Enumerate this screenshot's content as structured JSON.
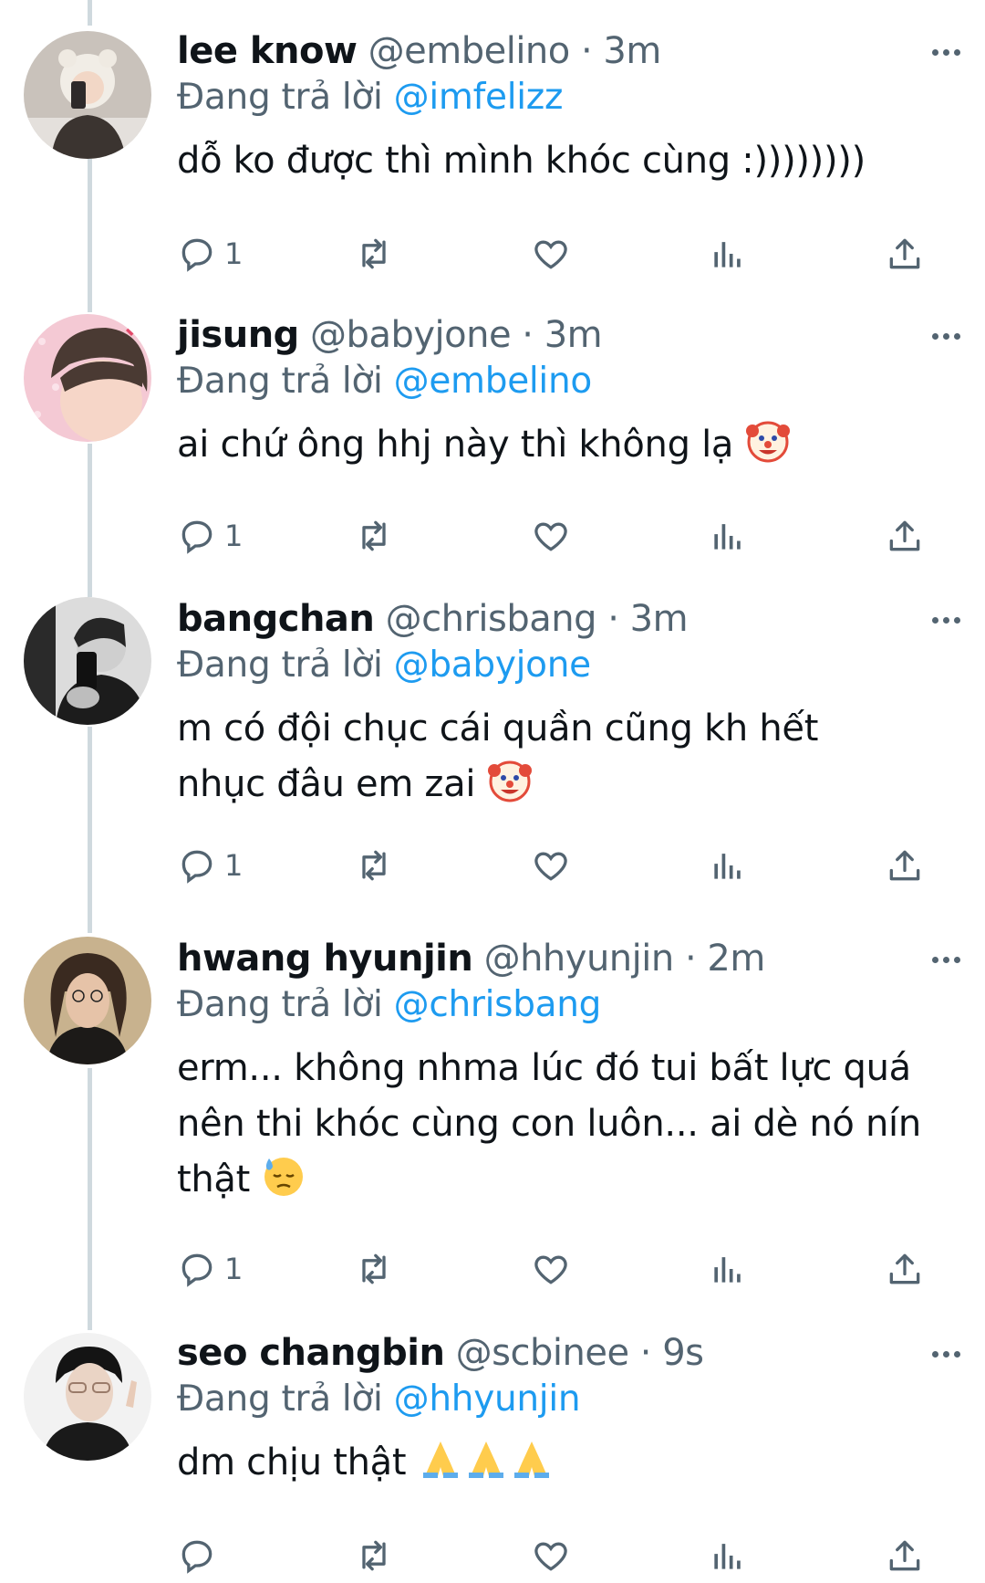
{
  "accent_color": "#1d9bf0",
  "replying_prefix": "Đang trả lời",
  "tweets": [
    {
      "name": "lee know",
      "handle": "@embelino",
      "time": "3m",
      "replying_to": "@imfelizz",
      "text": "dỗ ko được thì mình khóc cùng :))))))))",
      "reply_count": "1",
      "emoji": ""
    },
    {
      "name": "jisung",
      "handle": "@babyjone",
      "time": "3m",
      "replying_to": "@embelino",
      "text": "ai chứ ông hhj này thì không lạ",
      "reply_count": "1",
      "emoji": "clown-face"
    },
    {
      "name": "bangchan",
      "handle": "@chrisbang",
      "time": "3m",
      "replying_to": "@babyjone",
      "text": "m có đội chục cái quần cũng kh hết nhục đâu em zai",
      "reply_count": "1",
      "emoji": "clown-face"
    },
    {
      "name": "hwang hyunjin",
      "handle": "@hhyunjin",
      "time": "2m",
      "replying_to": "@chrisbang",
      "text": "erm... không nhma lúc đó tui bất lực quá nên thi khóc cùng con luôn... ai dè nó nín thật",
      "reply_count": "1",
      "emoji": "downcast-sweat-face"
    },
    {
      "name": "seo changbin",
      "handle": "@scbinee",
      "time": "9s",
      "replying_to": "@hhyunjin",
      "text": "dm chịu thật",
      "reply_count": "",
      "emoji": "folded-hands x3"
    }
  ]
}
